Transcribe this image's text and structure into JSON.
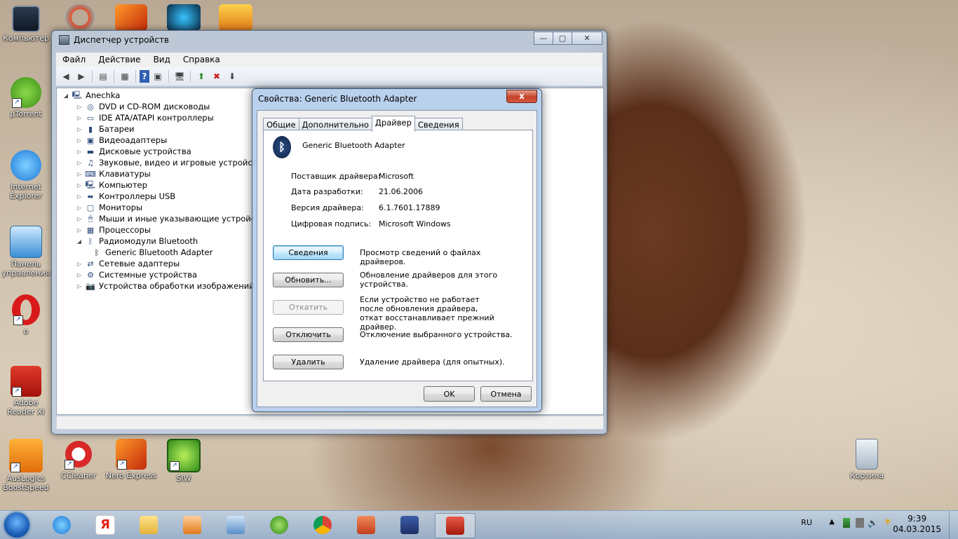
{
  "desktop": {
    "icons_left": [
      {
        "label": "Компьютер",
        "icon": "computer-icon"
      },
      {
        "label": "µTorrent",
        "icon": "utorrent-icon"
      },
      {
        "label": "Internet Explorer",
        "icon": "ie-icon"
      },
      {
        "label": "Панель управления",
        "icon": "control-panel-icon"
      },
      {
        "label": "o",
        "icon": "opera-icon"
      },
      {
        "label": "Adobe Reader XI",
        "icon": "adobe-reader-icon"
      },
      {
        "label": "AusLogics BoostSpeed",
        "icon": "auslogics-icon"
      }
    ],
    "icons_bottom": [
      {
        "label": "CCleaner",
        "icon": "ccleaner-icon"
      },
      {
        "label": "Nero Express",
        "icon": "nero-icon"
      },
      {
        "label": "SIW",
        "icon": "siw-icon"
      }
    ],
    "recycle": {
      "label": "Корзина",
      "icon": "recycle-bin-icon"
    }
  },
  "devmgr": {
    "title": "Диспетчер устройств",
    "menu": [
      "Файл",
      "Действие",
      "Вид",
      "Справка"
    ],
    "root": "Anechka",
    "categories": [
      "DVD и CD-ROM дисководы",
      "IDE ATA/ATAPI контроллеры",
      "Батареи",
      "Видеоадаптеры",
      "Дисковые устройства",
      "Звуковые, видео и игровые устройства",
      "Клавиатуры",
      "Компьютер",
      "Контроллеры USB",
      "Мониторы",
      "Мыши и иные указывающие устройства",
      "Процессоры",
      "Радиомодули Bluetooth",
      "Сетевые адаптеры",
      "Системные устройства",
      "Устройства обработки изображений"
    ],
    "bt_child": "Generic Bluetooth Adapter"
  },
  "dialog": {
    "title": "Свойства: Generic Bluetooth Adapter",
    "close": "x",
    "tabs": [
      "Общие",
      "Дополнительно",
      "Драйвер",
      "Сведения"
    ],
    "active_tab": "Драйвер",
    "device_name": "Generic Bluetooth Adapter",
    "fields": [
      {
        "label": "Поставщик драйвера:",
        "value": "Microsoft"
      },
      {
        "label": "Дата разработки:",
        "value": "21.06.2006"
      },
      {
        "label": "Версия драйвера:",
        "value": "6.1.7601.17889"
      },
      {
        "label": "Цифровая подпись:",
        "value": "Microsoft Windows"
      }
    ],
    "actions": [
      {
        "button": "Сведения",
        "desc": "Просмотр сведений о файлах драйверов."
      },
      {
        "button": "Обновить...",
        "desc": "Обновление драйверов для этого устройства."
      },
      {
        "button": "Откатить",
        "desc": "Если устройство не работает после обновления драйвера, откат восстанавливает прежний драйвер."
      },
      {
        "button": "Отключить",
        "desc": "Отключение выбранного устройства."
      },
      {
        "button": "Удалить",
        "desc": "Удаление драйвера (для опытных)."
      }
    ],
    "ok": "OK",
    "cancel": "Отмена"
  },
  "taskbar": {
    "lang": "RU",
    "time": "9:39",
    "date": "04.03.2015"
  }
}
